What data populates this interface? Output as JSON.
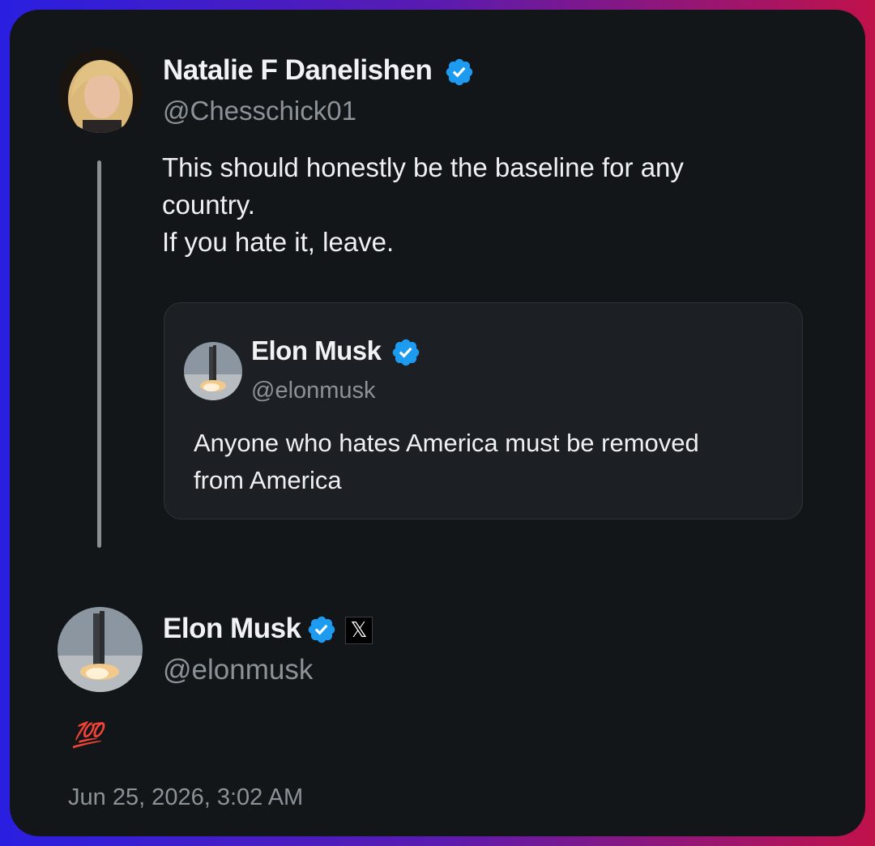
{
  "parent_tweet": {
    "author_name": "Natalie F Danelishen",
    "author_handle": "@Chesschick01",
    "verified": true,
    "text_lines": [
      "This should honestly be the baseline for any",
      "country.",
      "If you hate it, leave."
    ]
  },
  "quoted_tweet": {
    "author_name": "Elon Musk",
    "author_handle": "@elonmusk",
    "verified": true,
    "text_lines": [
      "Anyone who hates America must be removed",
      "from America"
    ]
  },
  "reply_tweet": {
    "author_name": "Elon Musk",
    "author_handle": "@elonmusk",
    "verified": true,
    "affiliate_badge": "𝕏",
    "text": "💯",
    "timestamp": "Jun 25, 2026, 3:02 AM"
  },
  "colors": {
    "verified_blue": "#1d9bf0",
    "card_background": "#131619",
    "hundred_red": "#e02030"
  }
}
